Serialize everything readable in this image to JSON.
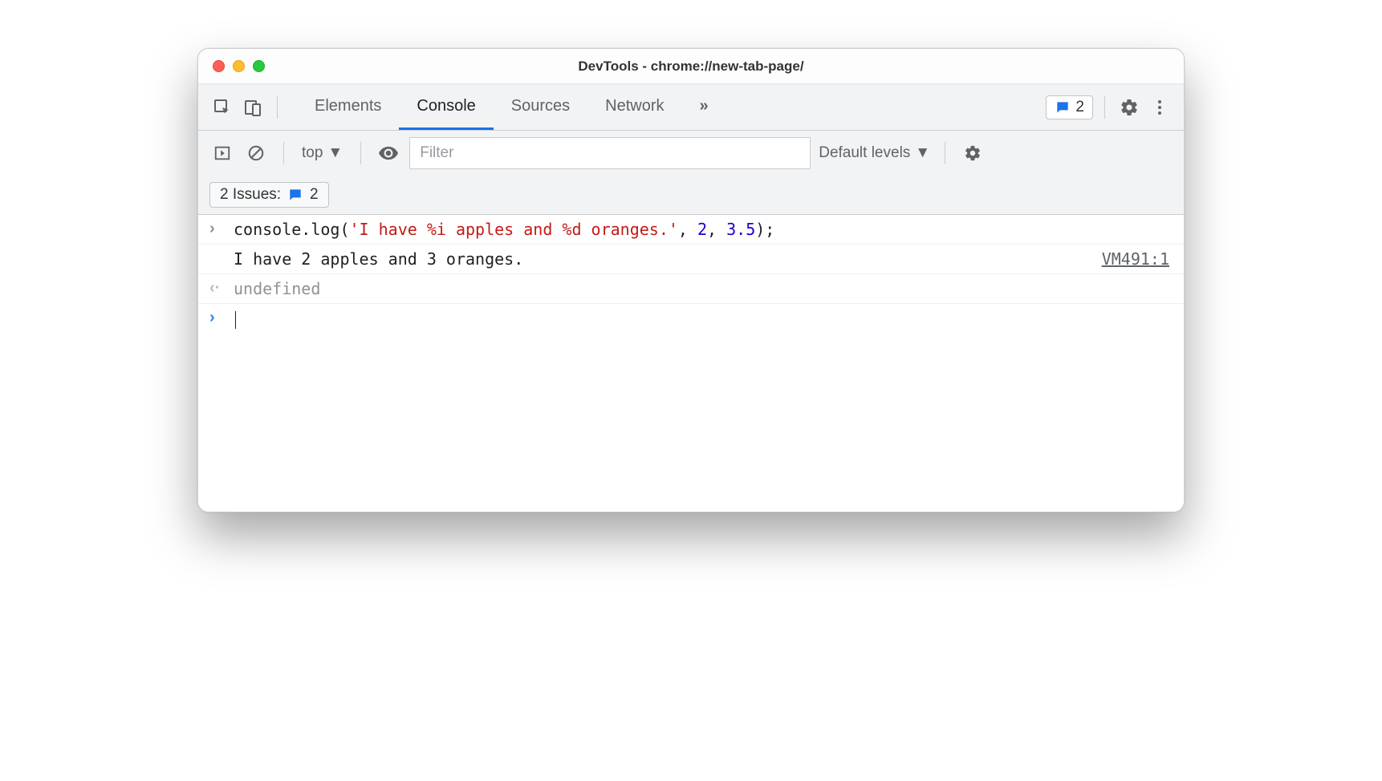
{
  "window": {
    "title": "DevTools - chrome://new-tab-page/"
  },
  "tabs": {
    "items": [
      "Elements",
      "Console",
      "Sources",
      "Network"
    ],
    "active": "Console",
    "overflow_glyph": "»"
  },
  "issues_badge": {
    "count": "2"
  },
  "subbar": {
    "context": "top",
    "filter_placeholder": "Filter",
    "levels_label": "Default levels",
    "issues_label": "2 Issues:",
    "issues_count": "2"
  },
  "console": {
    "input_method": "console.log",
    "input_str": "'I have %i apples and %d oranges.'",
    "input_arg1": "2",
    "input_arg2": "3.5",
    "output_text": "I have 2 apples and 3 oranges.",
    "source_link": "VM491:1",
    "return_value": "undefined"
  }
}
